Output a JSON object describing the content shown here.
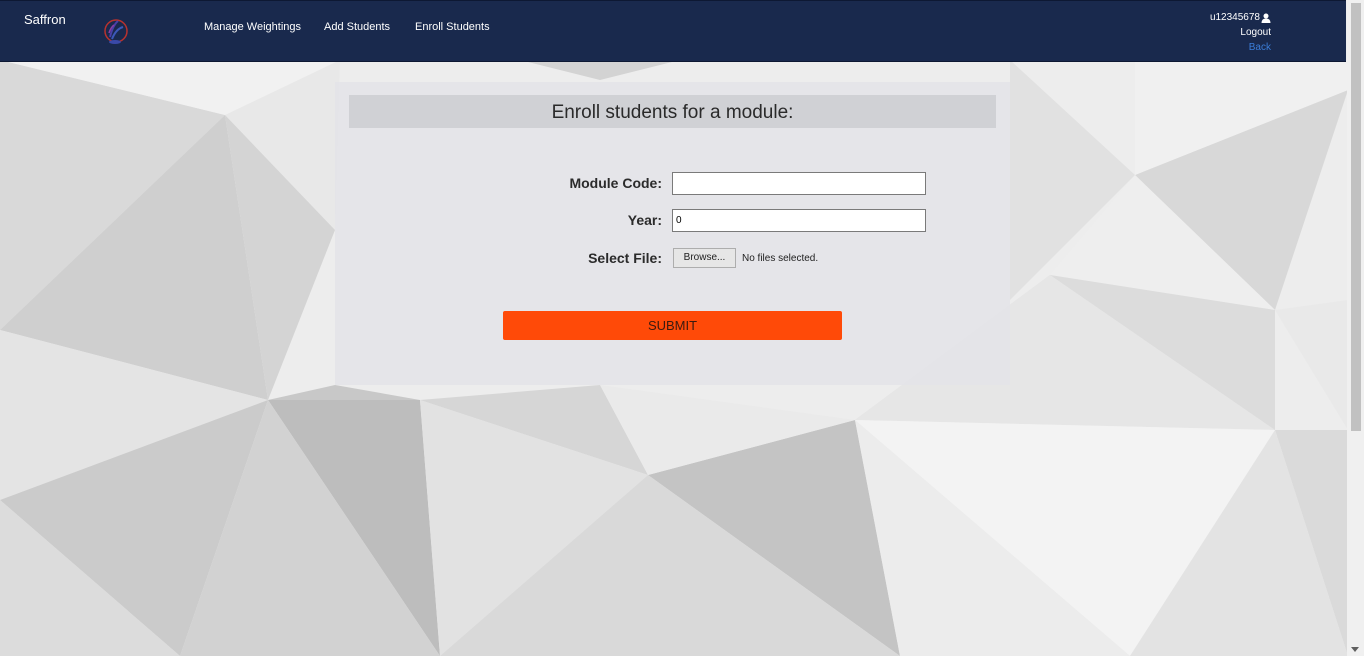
{
  "app": {
    "brand": "Saffron"
  },
  "nav": {
    "items": [
      {
        "label": "Manage Weightings"
      },
      {
        "label": "Add Students"
      },
      {
        "label": "Enroll Students"
      }
    ]
  },
  "user": {
    "username": "u12345678",
    "logout_label": "Logout",
    "back_label": "Back",
    "icon": "user-icon"
  },
  "form": {
    "title": "Enroll students for a module:",
    "module_code_label": "Module Code:",
    "module_code_value": "",
    "year_label": "Year:",
    "year_value": "0",
    "select_file_label": "Select File:",
    "browse_label": "Browse...",
    "file_status": "No files selected.",
    "submit_label": "SUBMIT"
  },
  "colors": {
    "navbar": "#19294d",
    "submit": "#ff4a08",
    "back_link": "#3b7dd8"
  }
}
